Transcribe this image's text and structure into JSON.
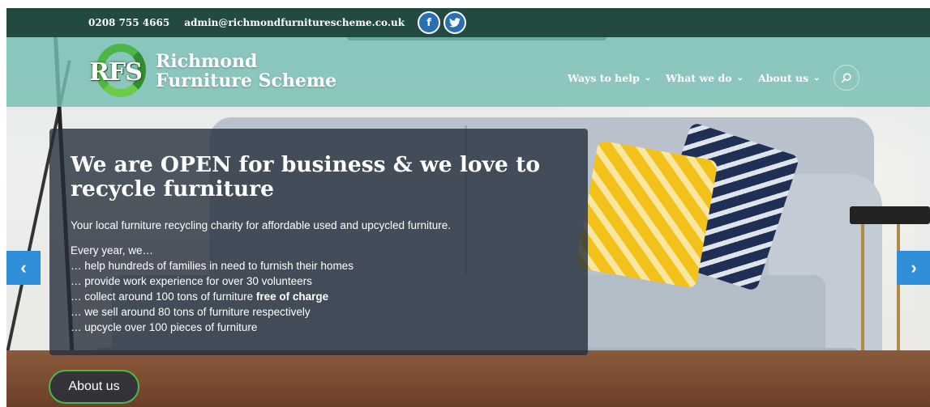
{
  "topbar": {
    "phone": "0208 755 4665",
    "email": "admin@richmondfurniturescheme.co.uk",
    "social": [
      {
        "icon": "facebook-icon",
        "glyph": "f"
      },
      {
        "icon": "twitter-icon",
        "glyph": "t"
      }
    ]
  },
  "header": {
    "logo_letters": "RFS",
    "logo_line1": "Richmond",
    "logo_line2": "Furniture Scheme",
    "nav": [
      {
        "label": "Ways to help",
        "chevron": "⌄"
      },
      {
        "label": "What we do",
        "chevron": "⌄"
      },
      {
        "label": "About us",
        "chevron": "⌄"
      }
    ]
  },
  "hero": {
    "title": "We are OPEN for business & we love to recycle furniture",
    "subtitle": "Your local furniture recycling charity for affordable used and upcycled furniture.",
    "list_intro": "Every year, we…",
    "list": [
      {
        "text": "… help hundreds of families in need to furnish their homes"
      },
      {
        "text": "… provide work experience for over 30 volunteers"
      },
      {
        "text": "… collect around 100 tons of furniture ",
        "bold": "free of charge"
      },
      {
        "text": "… we sell around 80 tons of furniture respectively"
      },
      {
        "text": "… upcycle over 100 pieces of furniture"
      }
    ],
    "button_label": "About us"
  },
  "carousel": {
    "prev_glyph": "‹",
    "next_glyph": "›"
  },
  "colors": {
    "topbar_bg": "#234a40",
    "header_bg": "#78beb4",
    "accent_green": "#4cb648",
    "arrow_blue": "#2f8fd8"
  }
}
